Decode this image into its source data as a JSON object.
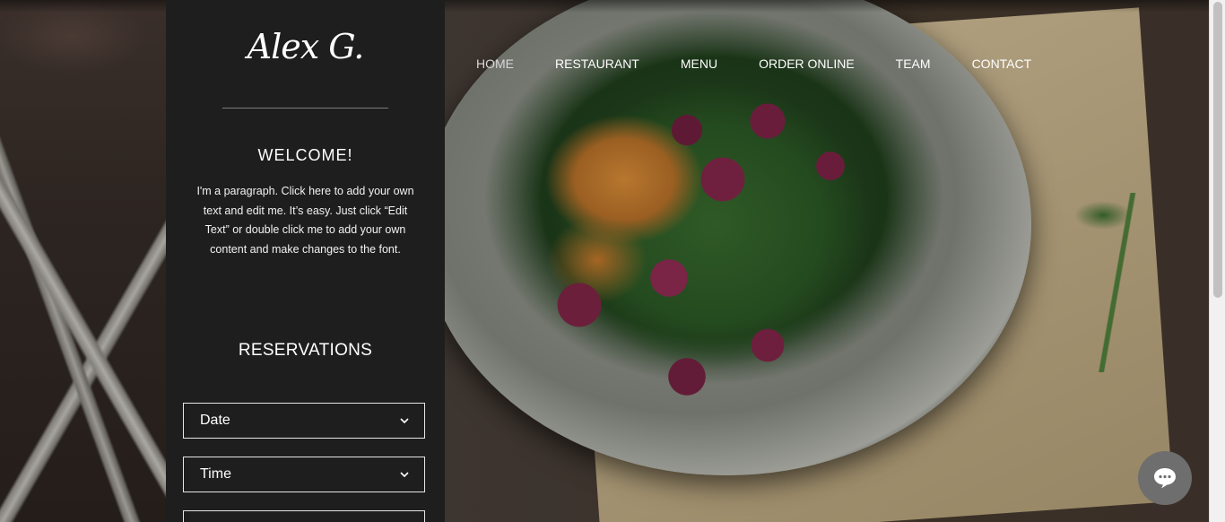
{
  "brand": {
    "logo_text": "Alex G."
  },
  "nav": {
    "items": [
      {
        "label": "HOME",
        "active": true
      },
      {
        "label": "RESTAURANT",
        "active": false
      },
      {
        "label": "MENU",
        "active": false
      },
      {
        "label": "ORDER ONLINE",
        "active": false
      },
      {
        "label": "TEAM",
        "active": false
      },
      {
        "label": "CONTACT",
        "active": false
      }
    ]
  },
  "welcome": {
    "title": "WELCOME!",
    "text": "I'm a paragraph. Click here to add your own text and edit me. It’s easy. Just click “Edit Text” or double click me to add your own content and make changes to the font."
  },
  "reservations": {
    "title": "RESERVATIONS",
    "date_label": "Date",
    "time_label": "Time",
    "third_label": ""
  },
  "icons": {
    "chevron": "chevron-down-icon",
    "chat": "chat-bubble-icon"
  },
  "colors": {
    "panel_bg": "#1e1e1e",
    "chat_bg": "#6e6e6e",
    "text": "#ffffff"
  }
}
